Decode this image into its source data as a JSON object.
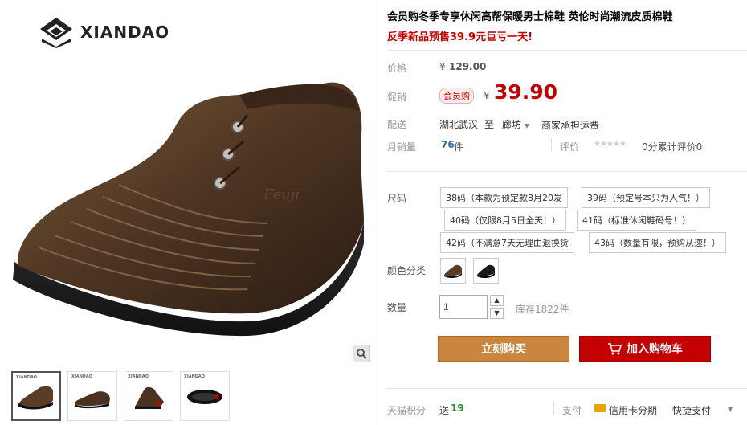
{
  "brand": {
    "logo_text": "XIANDAO"
  },
  "gallery": {
    "thumbs": [
      {
        "name": "thumb-1",
        "tag": "XIANDAO"
      },
      {
        "name": "thumb-2",
        "tag": "XIANDAO"
      },
      {
        "name": "thumb-3",
        "tag": "XIANDAO"
      },
      {
        "name": "thumb-4",
        "tag": "XIANDAO"
      }
    ]
  },
  "product": {
    "title": "会员购冬季专享休闲高帮保暖男士棉鞋 英伦时尚潮流皮质棉鞋",
    "promo": "反季新品预售39.9元巨亏一天!"
  },
  "meta": {
    "price_label": "价格",
    "price_currency": "¥",
    "price_original": "129.00",
    "promo_label": "促销",
    "promo_badge": "会员购",
    "promo_currency": "¥",
    "promo_price": "39.90",
    "delivery_label": "配送",
    "delivery_from": "湖北武汉",
    "delivery_to_word": "至",
    "delivery_to": "廊坊",
    "delivery_fee": "商家承担运费",
    "sales_label": "月销量",
    "sales_value": "76",
    "sales_unit": "件",
    "review_label": "评价",
    "review_stars": "★★★★★",
    "review_count": "0分累计评价0"
  },
  "options": {
    "size_label": "尺码",
    "sizes": [
      "38码（本款为预定款8月20发",
      "39码（预定号本只为人气！）",
      "40码（仅限8月5日全天！）",
      "41码（标准休闲鞋码号！）",
      "42码（不满意7天无理由退换货",
      "43码（数量有限，预购从速！）"
    ],
    "color_label": "颜色分类",
    "quantity_label": "数量",
    "quantity_value": "1",
    "stock": "库存1822件"
  },
  "actions": {
    "buy_now": "立刻购买",
    "add_to_cart": "加入购物车"
  },
  "footer": {
    "points_label": "天猫积分",
    "points_send": "送",
    "points_value": "19",
    "pay_label": "支付",
    "pay_credit": "信用卡分期",
    "pay_quick": "快捷支付"
  },
  "colors": {
    "accent_red": "#c40000",
    "buy_orange": "#c9863f",
    "link_blue": "#2b6aa3"
  }
}
